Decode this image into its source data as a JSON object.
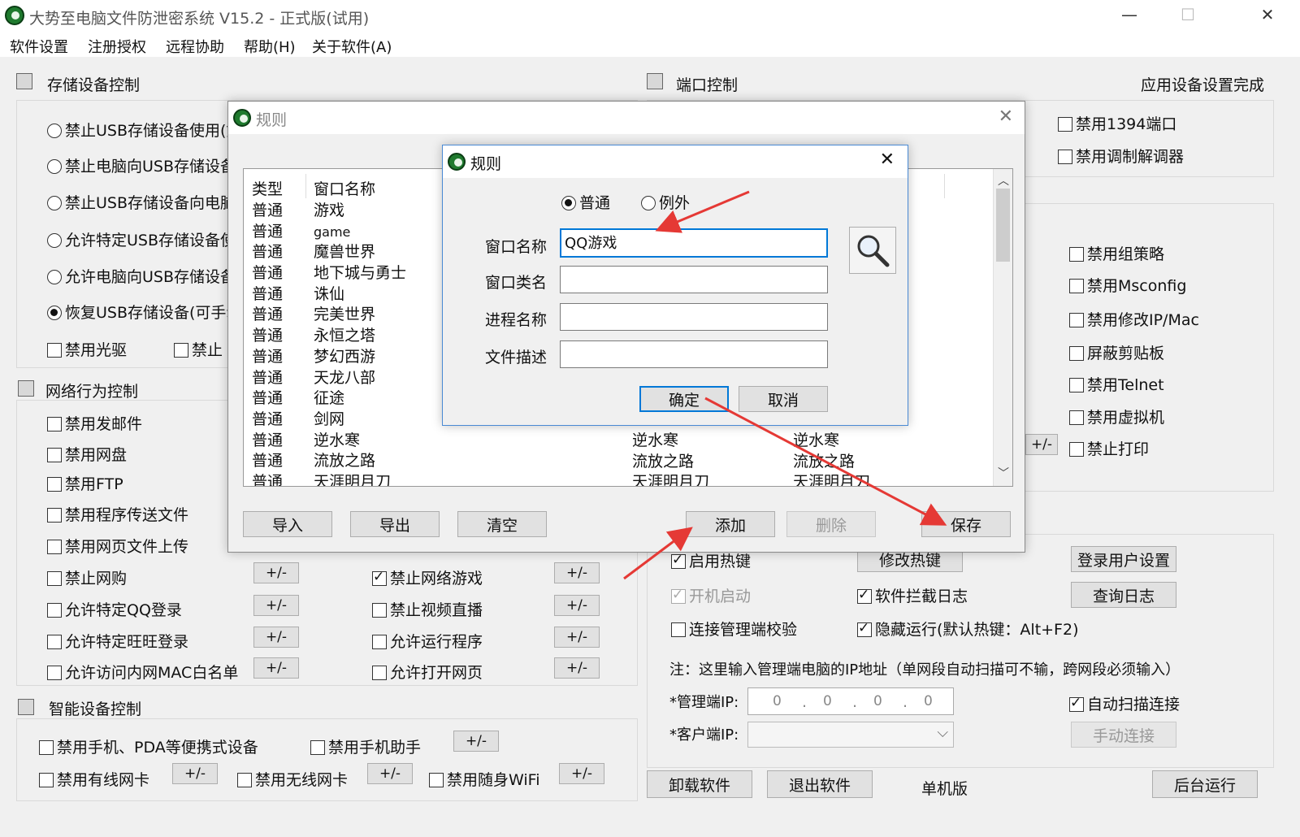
{
  "window": {
    "title": "大势至电脑文件防泄密系统 V15.2 - 正式版(试用)",
    "controls": {
      "minimize": "—",
      "maximize": "☐",
      "close": "✕"
    }
  },
  "menu": [
    "软件设置",
    "注册授权",
    "远程协助",
    "帮助(H)",
    "关于软件(A)"
  ],
  "storage": {
    "title": "存储设备控制",
    "options": [
      {
        "label": "禁止USB存储设备使用(如",
        "selected": false
      },
      {
        "label": "禁止电脑向USB存储设备",
        "selected": false
      },
      {
        "label": "禁止USB存储设备向电脑",
        "selected": false
      },
      {
        "label": "允许特定USB存储设备使",
        "selected": false
      },
      {
        "label": "允许电脑向USB存储设备",
        "selected": false
      },
      {
        "label": "恢复USB存储设备(可手动",
        "selected": true
      }
    ],
    "checks": [
      "禁用光驱",
      "禁止"
    ]
  },
  "network": {
    "title": "网络行为控制",
    "left": [
      "禁用发邮件",
      "禁用网盘",
      "禁用FTP",
      "禁用程序传送文件",
      "禁用网页文件上传",
      "禁止网购",
      "允许特定QQ登录",
      "允许特定旺旺登录",
      "允许访问内网MAC白名单"
    ],
    "right": [
      {
        "label": "禁止网络游戏",
        "checked": true
      },
      {
        "label": "禁止视频直播",
        "checked": false
      },
      {
        "label": "允许运行程序",
        "checked": false
      },
      {
        "label": "允许打开网页",
        "checked": false
      }
    ],
    "plusminus": "+/-"
  },
  "smart": {
    "title": "智能设备控制",
    "row1": [
      "禁用手机、PDA等便携式设备",
      "禁用手机助手"
    ],
    "row2": [
      "禁用有线网卡",
      "禁用无线网卡",
      "禁用随身WiFi"
    ],
    "plusminus": "+/-"
  },
  "port": {
    "title": "端口控制",
    "status": "应用设备设置完成",
    "checks_top": [
      "禁用1394端口",
      "禁用调制解调器"
    ],
    "checks_mid": [
      "禁用组策略",
      "禁用Msconfig",
      "禁用修改IP/Mac",
      "屏蔽剪贴板",
      "禁用Telnet",
      "禁用虚拟机",
      "禁止打印"
    ],
    "plusminus": "+/-"
  },
  "system": {
    "hotkey_enable": "启用热键",
    "hotkey_modify": "修改热键",
    "login_user": "登录用户设置",
    "autostart": "开机启动",
    "intercept_log": "软件拦截日志",
    "query_log": "查询日志",
    "connect_check": "连接管理端校验",
    "hidden_run": "隐藏运行(默认热键：Alt+F2)",
    "note": "注：这里输入管理端电脑的IP地址（单网段自动扫描可不输，跨网段必须输入）",
    "admin_ip_label": "*管理端IP:",
    "client_ip_label": "*客户端IP:",
    "ip_octets": [
      "0",
      "0",
      "0",
      "0"
    ],
    "auto_scan": "自动扫描连接",
    "manual_connect": "手动连接"
  },
  "bottom": {
    "uninstall": "卸载软件",
    "exit": "退出软件",
    "edition": "单机版",
    "background": "后台运行"
  },
  "rules_dialog": {
    "title": "规则",
    "close": "✕",
    "headers": [
      "类型",
      "窗口名称"
    ],
    "rows": [
      [
        "普通",
        "游戏"
      ],
      [
        "普通",
        "game"
      ],
      [
        "普通",
        "魔兽世界"
      ],
      [
        "普通",
        "地下城与勇士"
      ],
      [
        "普通",
        "诛仙"
      ],
      [
        "普通",
        "完美世界"
      ],
      [
        "普通",
        "永恒之塔"
      ],
      [
        "普通",
        "梦幻西游"
      ],
      [
        "普通",
        "天龙八部"
      ],
      [
        "普通",
        "征途"
      ],
      [
        "普通",
        "剑网"
      ],
      [
        "普通",
        "逆水寒"
      ],
      [
        "普通",
        "流放之路"
      ],
      [
        "普通",
        "天涯明月刀"
      ]
    ],
    "col3_tail": [
      "逆水寒",
      "流放之路",
      "天涯明月刀"
    ],
    "col4_tail": [
      "逆水寒",
      "流放之路",
      "天涯明月刀"
    ],
    "buttons": {
      "import": "导入",
      "export": "导出",
      "clear": "清空",
      "add": "添加",
      "delete": "删除",
      "save": "保存"
    }
  },
  "inner_dialog": {
    "title": "规则",
    "close": "✕",
    "radio_normal": "普通",
    "radio_exception": "例外",
    "window_name_label": "窗口名称",
    "window_name_value": "QQ游戏",
    "window_class_label": "窗口类名",
    "process_label": "进程名称",
    "file_desc_label": "文件描述",
    "ok": "确定",
    "cancel": "取消"
  },
  "colors": {
    "accent": "#0078d7",
    "arrow": "#e53935",
    "logo": "#1f7a2e"
  }
}
